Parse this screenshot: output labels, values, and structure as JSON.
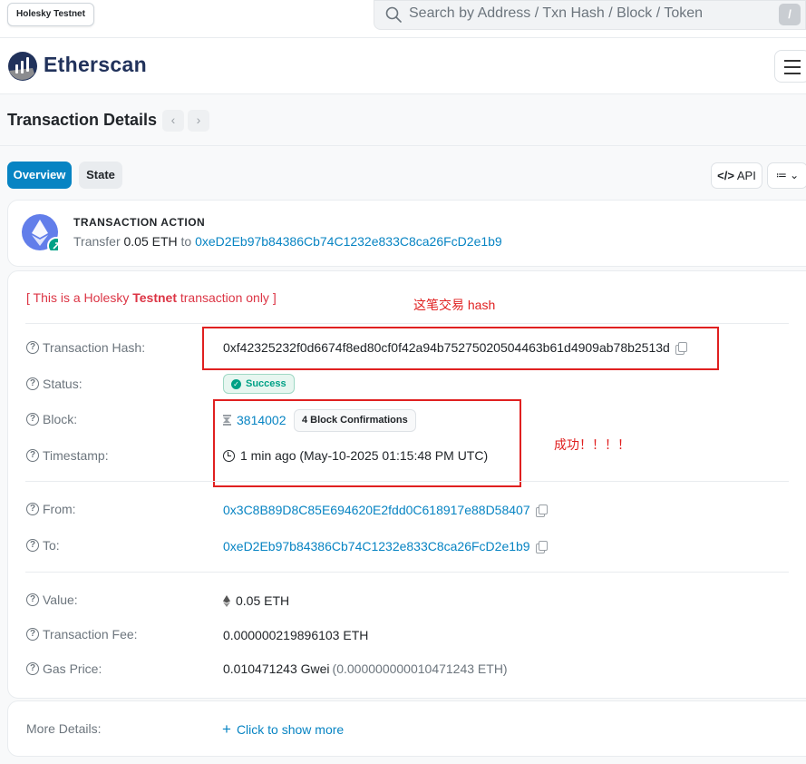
{
  "network_badge": "Holesky Testnet",
  "search": {
    "placeholder": "Search by Address / Txn Hash / Block / Token",
    "shortcut": "/"
  },
  "brand": {
    "name": "Etherscan"
  },
  "page": {
    "title": "Transaction Details",
    "prev": "‹",
    "next": "›"
  },
  "tabs": [
    {
      "label": "Overview",
      "active": true
    },
    {
      "label": "State",
      "active": false
    }
  ],
  "toolbar": {
    "api_label": "API",
    "list_label": "≔ ⌄"
  },
  "action": {
    "heading": "TRANSACTION ACTION",
    "verb": "Transfer",
    "amount": "0.05 ETH",
    "to_word": "to",
    "to_address": "0xeD2Eb97b84386Cb74C1232e833C8ca26FcD2e1b9"
  },
  "notice": {
    "prefix": "[ This is a Holesky ",
    "bold": "Testnet",
    "suffix": " transaction only ]"
  },
  "details": {
    "tx_hash": {
      "label": "Transaction Hash:",
      "value": "0xf42325232f0d6674f8ed80cf0f42a94b75275020504463b61d4909ab78b2513d"
    },
    "status": {
      "label": "Status:",
      "value": "Success"
    },
    "block": {
      "label": "Block:",
      "value": "3814002",
      "confirmations": "4 Block Confirmations"
    },
    "timestamp": {
      "label": "Timestamp:",
      "value": "1 min ago (May-10-2025 01:15:48 PM UTC)"
    },
    "from": {
      "label": "From:",
      "value": "0x3C8B89D8C85E694620E2fdd0C618917e88D58407"
    },
    "to": {
      "label": "To:",
      "value": "0xeD2Eb97b84386Cb74C1232e833C8ca26FcD2e1b9"
    },
    "value": {
      "label": "Value:",
      "value": "0.05 ETH"
    },
    "fee": {
      "label": "Transaction Fee:",
      "value": "0.000000219896103 ETH"
    },
    "gas_price": {
      "label": "Gas Price:",
      "value": "0.010471243 Gwei",
      "secondary": "(0.000000000010471243 ETH)"
    }
  },
  "more": {
    "label": "More Details:",
    "link": "Click to show more"
  },
  "annotations": {
    "hash_note": "这笔交易 hash",
    "success_note": "成功！！！！"
  },
  "colors": {
    "accent": "#0784c3",
    "success": "#00a186",
    "annotation": "#e02020",
    "brand": "#21325b"
  }
}
